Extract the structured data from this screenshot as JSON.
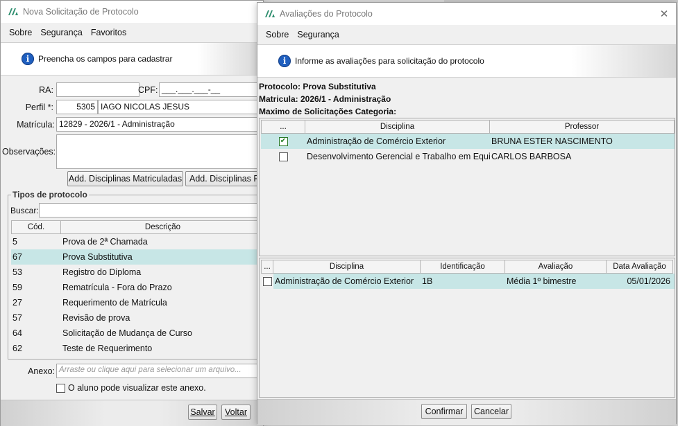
{
  "back_window": {
    "title": "Nova Solicitação de Protocolo",
    "menu": [
      "Sobre",
      "Segurança",
      "Favoritos"
    ],
    "info": "Preencha os campos para cadastrar",
    "labels": {
      "ra": "RA:",
      "cpf": "CPF:",
      "perfil": "Perfil *:",
      "matricula": "Matrícula:",
      "observacoes": "Observações:",
      "anexo": "Anexo:",
      "buscar": "Buscar:"
    },
    "fields": {
      "ra": "",
      "cpf_placeholder": "___.___.___-__",
      "perfil_code": "5305",
      "perfil_name": "IAGO NICOLAS JESUS",
      "matricula": "12829 - 2026/1 - Administração",
      "observacoes": "",
      "buscar": "",
      "anexo_placeholder": "Arraste ou clique aqui para selecionar um arquivo..."
    },
    "buttons": {
      "add_matriculadas": "Add. Disciplinas Matriculadas",
      "add_pe": "Add. Disciplinas Pe",
      "salvar": "Salvar",
      "voltar": "Voltar"
    },
    "tipos": {
      "legend": "Tipos de protocolo",
      "columns": [
        "Cód.",
        "Descrição"
      ],
      "rows": [
        {
          "code": "5",
          "desc": "Prova de 2ª Chamada"
        },
        {
          "code": "67",
          "desc": "Prova Substitutiva"
        },
        {
          "code": "53",
          "desc": "Registro do Diploma"
        },
        {
          "code": "59",
          "desc": "Rematrícula - Fora do Prazo"
        },
        {
          "code": "27",
          "desc": "Requerimento de Matrícula"
        },
        {
          "code": "57",
          "desc": "Revisão de prova"
        },
        {
          "code": "64",
          "desc": "Solicitação de Mudança de Curso"
        },
        {
          "code": "62",
          "desc": "Teste de Requerimento"
        }
      ],
      "selected_index": 1
    },
    "anexo_checkbox_label": "O aluno pode visualizar este anexo."
  },
  "dialog": {
    "title": "Avaliações do Protocolo",
    "menu": [
      "Sobre",
      "Segurança"
    ],
    "info": "Informe as avaliações para solicitação do protocolo",
    "protocolo": "Protocolo: Prova Substitutiva",
    "matricula": "Matricula: 2026/1 - Administração",
    "maximo": "Maximo de Solicitações Categoria:",
    "disciplinas": {
      "columns": [
        "...",
        "Disciplina",
        "Professor"
      ],
      "rows": [
        {
          "checked": true,
          "disciplina": "Administração de Comércio Exterior",
          "professor": "BRUNA ESTER NASCIMENTO"
        },
        {
          "checked": false,
          "disciplina": "Desenvolvimento Gerencial e Trabalho em Equipe",
          "professor": "CARLOS BARBOSA"
        }
      ]
    },
    "avaliacoes": {
      "columns": [
        "...",
        "Disciplina",
        "Identificação",
        "Avaliação",
        "Data Avaliação"
      ],
      "rows": [
        {
          "checked": false,
          "disciplina": "Administração de Comércio Exterior",
          "identificacao": "1B",
          "avaliacao": "Média 1º bimestre",
          "data": "05/01/2026"
        }
      ]
    },
    "buttons": {
      "confirmar": "Confirmar",
      "cancelar": "Cancelar"
    }
  },
  "colors": {
    "selected_row": "#c7e6e6",
    "info_icon": "#1f5fbf"
  }
}
